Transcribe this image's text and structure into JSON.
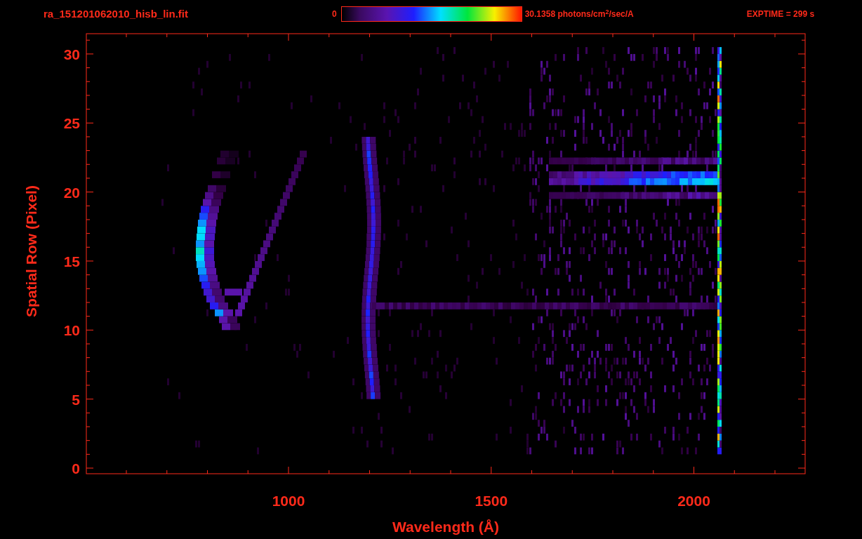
{
  "header": {
    "title": "ra_151201062010_hisb_lin.fit",
    "colorbar_min": "0",
    "colorbar_max": "30.1358 photons/cm$^{2}$/sec/A",
    "exptime": "EXPTIME = 299 s"
  },
  "plot": {
    "xlabel": "Wavelength (Å)",
    "ylabel": "Spatial Row (Pixel)",
    "xtick_labels": [
      "1000",
      "1500",
      "2000"
    ],
    "ytick_labels": [
      "30",
      "25",
      "20",
      "15",
      "10",
      "5",
      "0"
    ]
  }
}
